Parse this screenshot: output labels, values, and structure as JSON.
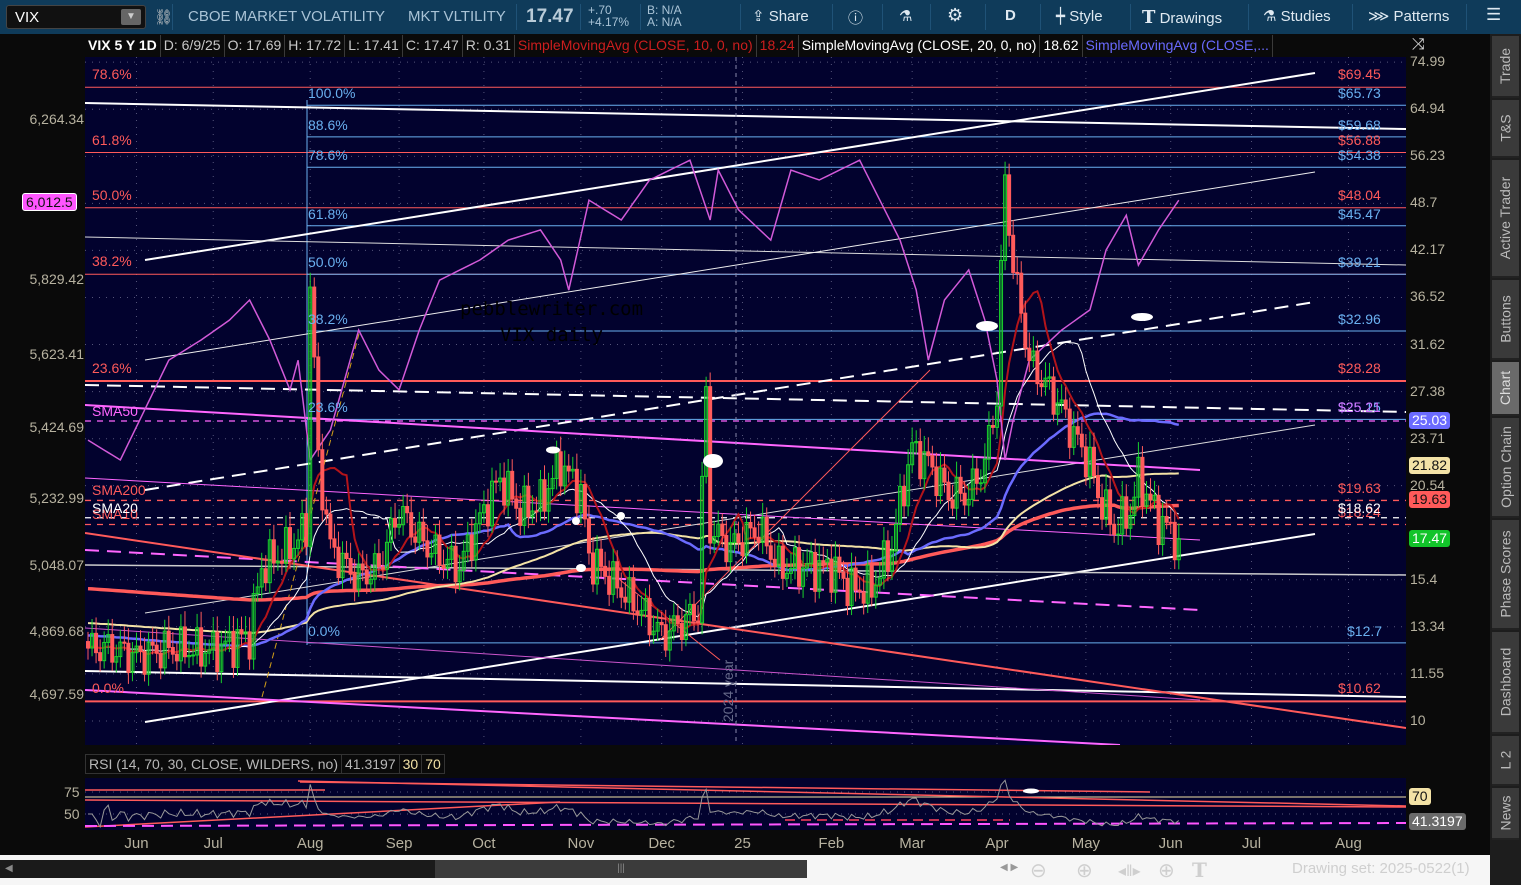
{
  "toolbar": {
    "symbol": "VIX",
    "description": "CBOE MARKET VOLATILITY",
    "short_name": "MKT VLTILITY",
    "last": "17.47",
    "change": "+.70",
    "change_pct": "+4.17%",
    "bid": "B: N/A",
    "ask": "A: N/A",
    "share": "Share",
    "timeframe": "D",
    "style": "Style",
    "drawings": "Drawings",
    "studies": "Studies",
    "patterns": "Patterns"
  },
  "header": {
    "title": "VIX 5 Y 1D",
    "date": "D: 6/9/25",
    "open": "O: 17.69",
    "high": "H: 17.72",
    "low": "L: 17.41",
    "close": "C: 17.47",
    "range": "R: 0.31",
    "sma10_label": "SimpleMovingAvg (CLOSE, 10, 0, no)",
    "sma10_val": "18.24",
    "sma20_label": "SimpleMovingAvg (CLOSE, 20, 0, no)",
    "sma20_val": "18.62",
    "sma50_label": "SimpleMovingAvg (CLOSE,..."
  },
  "left_axis": [
    "6,264.34",
    "5,829.42",
    "5,623.41",
    "5,424.69",
    "5,232.99",
    "5,048.07",
    "4,869.68",
    "4,697.59"
  ],
  "left_badge": "6,012.5",
  "right_axis": [
    "74.99",
    "64.94",
    "56.23",
    "48.7",
    "42.17",
    "36.52",
    "31.62",
    "27.38",
    "23.71",
    "20.54",
    "15.4",
    "13.34",
    "11.55",
    "10"
  ],
  "right_axis_values": [
    74.99,
    64.94,
    56.23,
    48.7,
    42.17,
    36.52,
    31.62,
    27.38,
    23.71,
    20.54,
    15.4,
    13.34,
    11.55,
    10
  ],
  "badges": [
    {
      "text": "25.03",
      "value": 25.03,
      "bg": "#6b6bff",
      "fg": "#ffffff"
    },
    {
      "text": "21.82",
      "value": 21.82,
      "bg": "#f3e2a6",
      "fg": "#111111"
    },
    {
      "text": "19.63",
      "value": 19.63,
      "bg": "#ff5a5a",
      "fg": "#111111"
    },
    {
      "text": "17.47",
      "value": 17.47,
      "bg": "#12c42a",
      "fg": "#ffffff"
    }
  ],
  "fib_red": [
    {
      "pct": "78.6%",
      "value": 69.45,
      "price": "$69.45"
    },
    {
      "pct": "61.8%",
      "value": 56.88,
      "price": "$56.88"
    },
    {
      "pct": "50.0%",
      "value": 48.04,
      "price": "$48.04"
    },
    {
      "pct": "38.2%",
      "value": 39.21,
      "price": ""
    },
    {
      "pct": "23.6%",
      "value": 28.28,
      "price": "$28.28"
    },
    {
      "pct": "0.0%",
      "value": 10.62,
      "price": "$10.62"
    }
  ],
  "fib_blue": [
    {
      "pct": "100.0%",
      "value": 65.73,
      "price": "$65.73"
    },
    {
      "pct": "88.6%",
      "value": 59.68,
      "price": "$59.68"
    },
    {
      "pct": "78.6%",
      "value": 54.38,
      "price": "$54.38"
    },
    {
      "pct": "61.8%",
      "value": 45.47,
      "price": "$45.47"
    },
    {
      "pct": "50.0%",
      "value": 39.21,
      "price": "$39.21"
    },
    {
      "pct": "38.2%",
      "value": 32.96,
      "price": "$32.96"
    },
    {
      "pct": "23.6%",
      "value": 25.15,
      "price": "$25.15"
    },
    {
      "pct": "0.0%",
      "value": 12.7,
      "price": "$12.7"
    }
  ],
  "extra_prices": [
    {
      "text": "$25.21",
      "value": 25.21,
      "color": "#d070ff"
    },
    {
      "text": "$19.63",
      "value": 19.63,
      "color": "#ff5a5a"
    },
    {
      "text": "$18.24",
      "value": 18.24,
      "color": "#ff5a5a"
    },
    {
      "text": "$18.62",
      "value": 18.62,
      "color": "#ffffff"
    }
  ],
  "ma_labels": [
    {
      "text": "SMA50",
      "value": 25.03,
      "color": "#ff66ff"
    },
    {
      "text": "SMA200",
      "value": 19.63,
      "color": "#ff5a5a"
    },
    {
      "text": "SMA10",
      "value": 18.24,
      "color": "#ff5a5a"
    },
    {
      "text": "SMA20",
      "value": 18.62,
      "color": "#ffffff"
    }
  ],
  "watermark": [
    "pebblewriter.com",
    "VIX daily"
  ],
  "year_marker": "2024 year",
  "x_labels": [
    {
      "t": "Jun",
      "day": 12
    },
    {
      "t": "Jul",
      "day": 31
    },
    {
      "t": "Aug",
      "day": 55
    },
    {
      "t": "Sep",
      "day": 77
    },
    {
      "t": "Oct",
      "day": 98
    },
    {
      "t": "Nov",
      "day": 122
    },
    {
      "t": "Dec",
      "day": 142
    },
    {
      "t": "25",
      "day": 162
    },
    {
      "t": "Feb",
      "day": 184
    },
    {
      "t": "Mar",
      "day": 204
    },
    {
      "t": "Apr",
      "day": 225
    },
    {
      "t": "May",
      "day": 247
    },
    {
      "t": "Jun",
      "day": 268
    },
    {
      "t": "Jul",
      "day": 288
    },
    {
      "t": "Aug",
      "day": 312
    }
  ],
  "vix_keypoints": [
    [
      0,
      12.5
    ],
    [
      5,
      12.5
    ],
    [
      12,
      12.2
    ],
    [
      20,
      12.5
    ],
    [
      31,
      12.4
    ],
    [
      40,
      13
    ],
    [
      43,
      16
    ],
    [
      50,
      17
    ],
    [
      54,
      18
    ],
    [
      55,
      38
    ],
    [
      57,
      22
    ],
    [
      60,
      17
    ],
    [
      64,
      16
    ],
    [
      67,
      15.5
    ],
    [
      72,
      16
    ],
    [
      77,
      19
    ],
    [
      82,
      17.5
    ],
    [
      87,
      16.5
    ],
    [
      92,
      16
    ],
    [
      98,
      19
    ],
    [
      102,
      21
    ],
    [
      107,
      19
    ],
    [
      112,
      19.5
    ],
    [
      117,
      22
    ],
    [
      122,
      20
    ],
    [
      124,
      16.5
    ],
    [
      129,
      15.5
    ],
    [
      137,
      14
    ],
    [
      142,
      13
    ],
    [
      147,
      13.5
    ],
    [
      151,
      14
    ],
    [
      153,
      27
    ],
    [
      154,
      18
    ],
    [
      159,
      17
    ],
    [
      162,
      17.5
    ],
    [
      166,
      18
    ],
    [
      171,
      16
    ],
    [
      176,
      16
    ],
    [
      184,
      16
    ],
    [
      189,
      15
    ],
    [
      194,
      15
    ],
    [
      199,
      17
    ],
    [
      204,
      23
    ],
    [
      208,
      22
    ],
    [
      213,
      20
    ],
    [
      218,
      20
    ],
    [
      222,
      22
    ],
    [
      225,
      27
    ],
    [
      227,
      52
    ],
    [
      229,
      40
    ],
    [
      231,
      35
    ],
    [
      233,
      30
    ],
    [
      237,
      28
    ],
    [
      241,
      26
    ],
    [
      244,
      24
    ],
    [
      248,
      22
    ],
    [
      250,
      20
    ],
    [
      254,
      18
    ],
    [
      258,
      19
    ],
    [
      260,
      21
    ],
    [
      265,
      18.5
    ],
    [
      270,
      17.47
    ]
  ],
  "spx_keypoints": [
    [
      0,
      5392
    ],
    [
      8,
      5338
    ],
    [
      20,
      5610
    ],
    [
      28,
      5665
    ],
    [
      35,
      5719
    ],
    [
      40,
      5774
    ],
    [
      45,
      5665
    ],
    [
      50,
      5529
    ],
    [
      52,
      5610
    ],
    [
      55,
      5338
    ],
    [
      60,
      5420
    ],
    [
      67,
      5692
    ],
    [
      72,
      5583
    ],
    [
      77,
      5529
    ],
    [
      82,
      5692
    ],
    [
      87,
      5828
    ],
    [
      97,
      5883
    ],
    [
      104,
      5937
    ],
    [
      112,
      5965
    ],
    [
      117,
      5883
    ],
    [
      119,
      5801
    ],
    [
      124,
      6046
    ],
    [
      132,
      5992
    ],
    [
      139,
      6101
    ],
    [
      149,
      6155
    ],
    [
      154,
      5992
    ],
    [
      156,
      6128
    ],
    [
      161,
      6020
    ],
    [
      169,
      5937
    ],
    [
      174,
      6128
    ],
    [
      181,
      6101
    ],
    [
      191,
      6155
    ],
    [
      196,
      6046
    ],
    [
      201,
      5937
    ],
    [
      205,
      5801
    ],
    [
      208,
      5610
    ],
    [
      212,
      5774
    ],
    [
      218,
      5856
    ],
    [
      222,
      5719
    ],
    [
      225,
      5556
    ],
    [
      227,
      5338
    ],
    [
      229,
      5447
    ],
    [
      233,
      5610
    ],
    [
      241,
      5692
    ],
    [
      248,
      5747
    ],
    [
      252,
      5910
    ],
    [
      257,
      6005
    ],
    [
      260,
      5869
    ],
    [
      265,
      5965
    ],
    [
      270,
      6046
    ]
  ],
  "rsi": {
    "label": "RSI (14, 70, 30, CLOSE, WILDERS, no)",
    "value": "41.3197",
    "os": "30",
    "ob": "70",
    "axis": [
      "75",
      "50"
    ],
    "badge_ob": "70",
    "badge_val": "41.3197"
  },
  "colors": {
    "up": "#19d12b",
    "down": "#ff5b5b",
    "sma10": "#b3141a",
    "sma20": "#ffffff",
    "sma50": "#6b6bff",
    "sma200": "#ff5a5a",
    "sma100": "#f3e2a6",
    "spx": "#d25ad8"
  },
  "side_tabs": [
    "Trade",
    "T&S",
    "Active Trader",
    "Buttons",
    "Chart",
    "Option Chain",
    "Phase Scores",
    "Dashboard",
    "L 2",
    "News"
  ],
  "drawing_set": "Drawing set: 2025-0522(1)"
}
